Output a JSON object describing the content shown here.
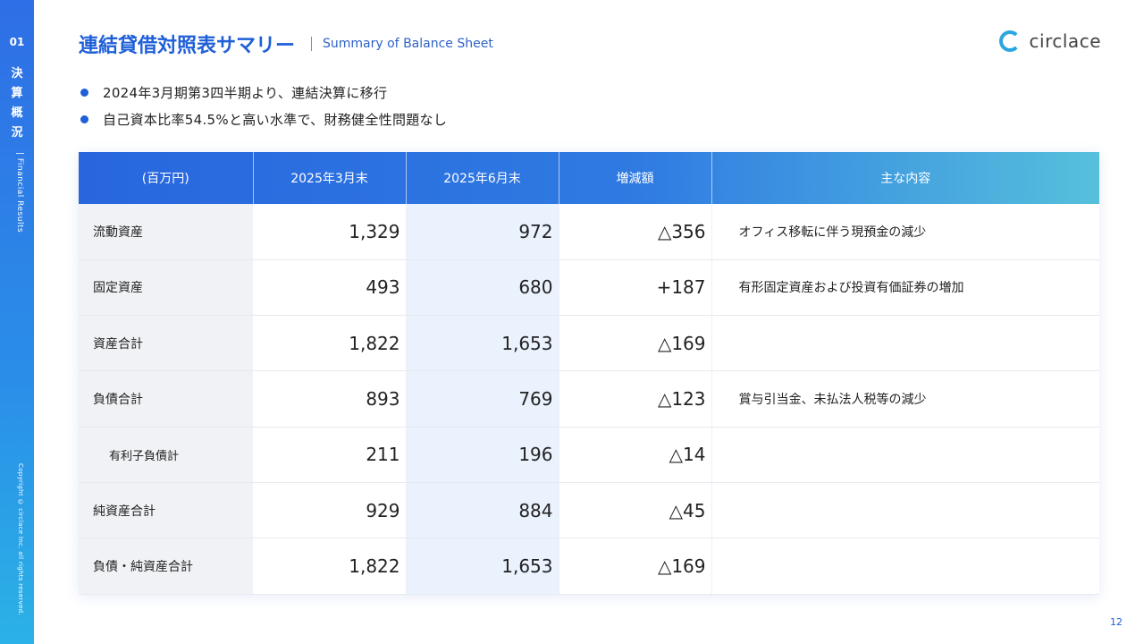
{
  "sidebar": {
    "number": "01",
    "section_chars": [
      "決",
      "算",
      "概",
      "況"
    ],
    "section_en": "| Financial Results",
    "copyright": "Copyright © circlace Inc. all rights reserved."
  },
  "header": {
    "title": "連結貸借対照表サマリー",
    "subtitle": "Summary of Balance Sheet",
    "logo_text": "circlace"
  },
  "bullets": [
    "2024年3月期第3四半期より、連結決算に移行",
    "自己資本比率54.5%と高い水準で、財務健全性問題なし"
  ],
  "table": {
    "headers": [
      "(百万円)",
      "2025年3月末",
      "2025年6月末",
      "増減額",
      "主な内容"
    ],
    "rows": [
      {
        "label": "流動資産",
        "mar": "1,329",
        "jun": "972",
        "diff": "△356",
        "note": "オフィス移転に伴う現預金の減少"
      },
      {
        "label": "固定資産",
        "mar": "493",
        "jun": "680",
        "diff": "+187",
        "note": "有形固定資産および投資有価証券の増加"
      },
      {
        "label": "資産合計",
        "mar": "1,822",
        "jun": "1,653",
        "diff": "△169",
        "note": ""
      },
      {
        "label": "負債合計",
        "mar": "893",
        "jun": "769",
        "diff": "△123",
        "note": "賞与引当金、未払法人税等の減少"
      },
      {
        "label": "有利子負債計",
        "mar": "211",
        "jun": "196",
        "diff": "△14",
        "note": ""
      },
      {
        "label": "純資産合計",
        "mar": "929",
        "jun": "884",
        "diff": "△45",
        "note": ""
      },
      {
        "label": "負債・純資産合計",
        "mar": "1,822",
        "jun": "1,653",
        "diff": "△169",
        "note": ""
      }
    ]
  },
  "page_number": "12",
  "colors": {
    "accent": "#1f5fd8",
    "header_gradient_start": "#2866de",
    "header_gradient_end": "#56c0dc",
    "highlight_column": "#eaf2fd"
  }
}
